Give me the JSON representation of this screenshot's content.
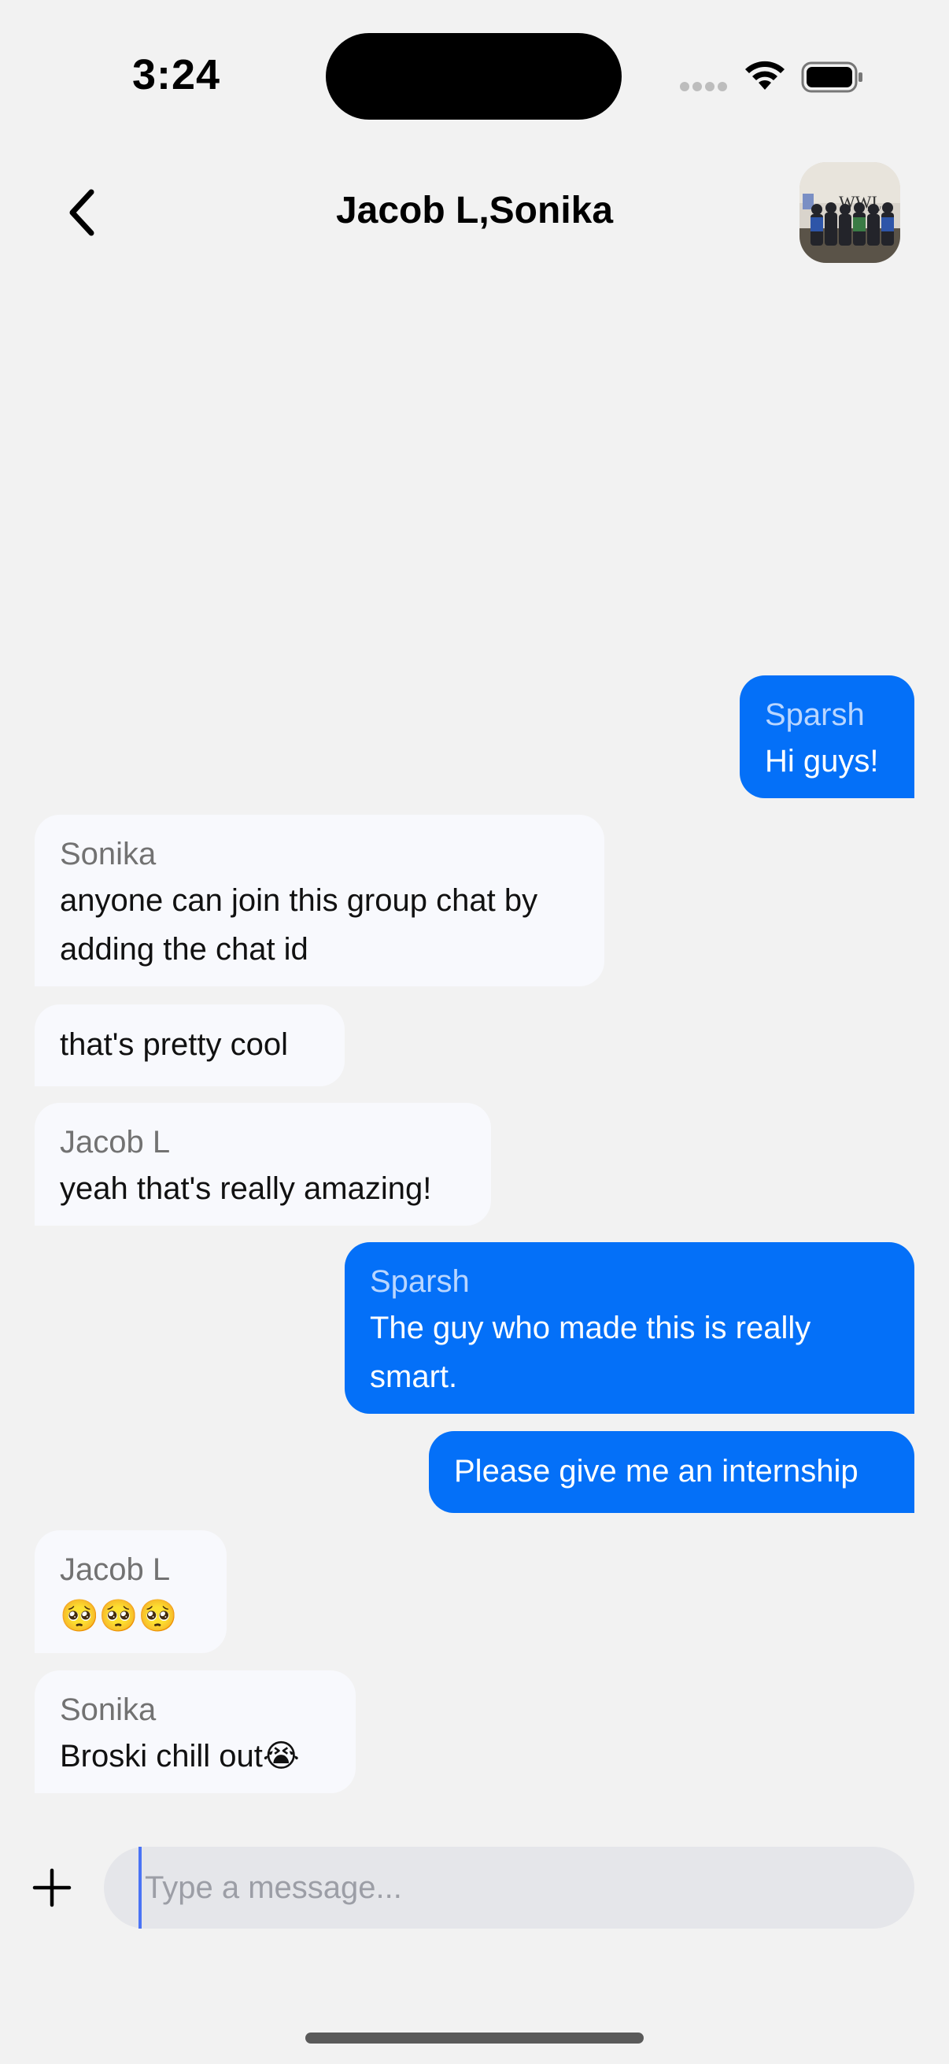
{
  "status_bar": {
    "time": "3:24"
  },
  "header": {
    "title": "Jacob L,Sonika",
    "avatar_icon": "group-photo-avatar"
  },
  "messages": [
    {
      "direction": "out",
      "sender": "Sparsh",
      "text": "Hi guys!"
    },
    {
      "direction": "in",
      "sender": "Sonika",
      "text": "anyone can join this group chat by adding the chat id"
    },
    {
      "direction": "in",
      "sender": "",
      "text": "that's pretty cool"
    },
    {
      "direction": "in",
      "sender": "Jacob L",
      "text": "yeah that's really amazing!"
    },
    {
      "direction": "out",
      "sender": "Sparsh",
      "text": "The guy who made this is really smart."
    },
    {
      "direction": "out",
      "sender": "",
      "text": "Please give me an internship"
    },
    {
      "direction": "in",
      "sender": "Jacob L",
      "text": "🥺🥺🥺"
    },
    {
      "direction": "in",
      "sender": "Sonika",
      "text": "Broski chill out😭"
    }
  ],
  "composer": {
    "placeholder": "Type a message...",
    "value": "",
    "add_icon": "plus-icon"
  },
  "colors": {
    "background": "#f2f2f2",
    "outgoing_bubble": "#0470f8",
    "incoming_bubble": "#f8f9fd",
    "input_background": "#e5e6ea"
  }
}
